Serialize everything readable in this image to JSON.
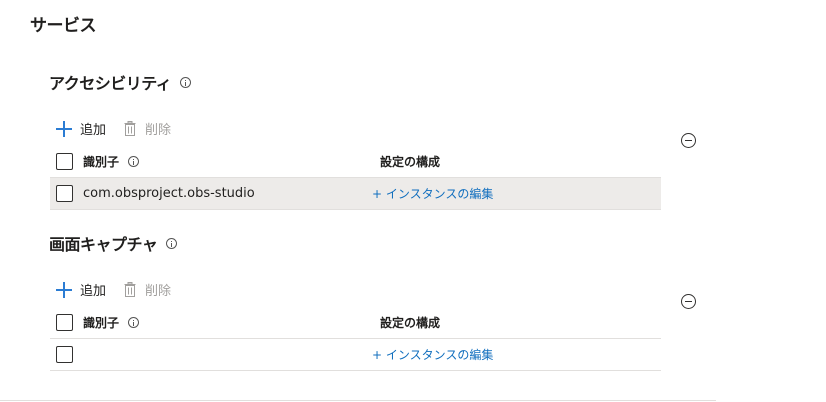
{
  "page": {
    "title": "サービス"
  },
  "sections": [
    {
      "title": "アクセシビリティ",
      "toolbar": {
        "add_label": "追加",
        "delete_label": "削除"
      },
      "table": {
        "headers": {
          "identifier": "識別子",
          "config": "設定の構成"
        },
        "rows": [
          {
            "identifier": "com.obsproject.obs-studio",
            "edit_label": "+ インスタンスの編集"
          }
        ]
      }
    },
    {
      "title": "画面キャプチャ",
      "toolbar": {
        "add_label": "追加",
        "delete_label": "削除"
      },
      "table": {
        "headers": {
          "identifier": "識別子",
          "config": "設定の構成"
        },
        "rows": [
          {
            "identifier": "",
            "edit_label": "+ インスタンスの編集"
          }
        ]
      }
    }
  ],
  "colors": {
    "accent": "#2b7cd3",
    "link": "#106ebe",
    "selected_row": "#edebe9"
  }
}
